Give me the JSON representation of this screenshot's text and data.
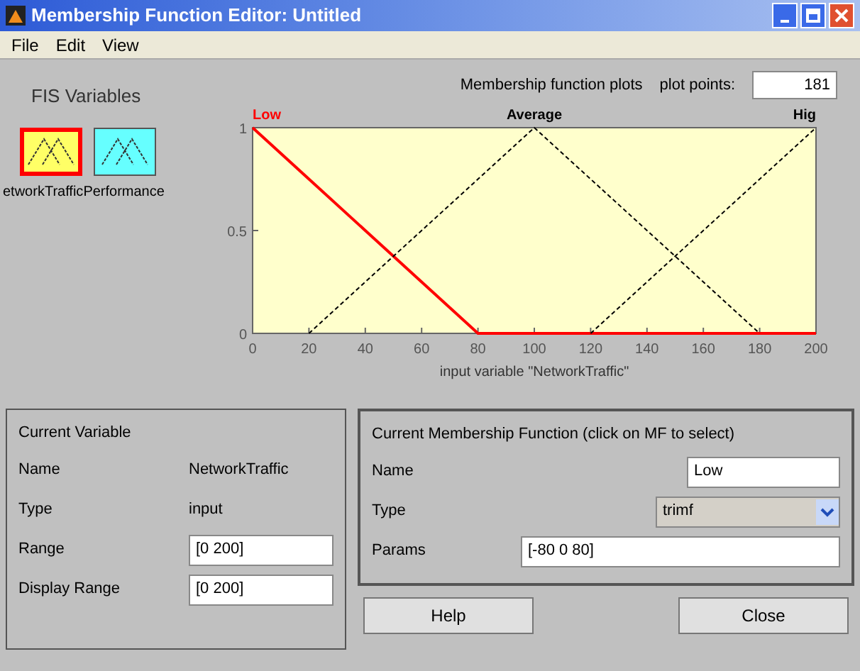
{
  "window": {
    "title": "Membership Function Editor: Untitled"
  },
  "menu": [
    "File",
    "Edit",
    "View"
  ],
  "fis_variables": {
    "title": "FIS Variables",
    "items": [
      {
        "label": "etworkTraffic",
        "selected": true
      },
      {
        "label": "Performance",
        "selected": false
      }
    ]
  },
  "plot_header": {
    "title": "Membership function plots",
    "points_label": "plot points:",
    "points_value": "181"
  },
  "chart_data": {
    "type": "line",
    "xlabel": "input variable \"NetworkTraffic\"",
    "x": [
      0,
      20,
      40,
      60,
      80,
      100,
      120,
      140,
      160,
      180,
      200
    ],
    "xlim": [
      0,
      200
    ],
    "ylim": [
      0,
      1
    ],
    "xticks": [
      0,
      20,
      40,
      60,
      80,
      100,
      120,
      140,
      160,
      180,
      200
    ],
    "yticks": [
      0,
      0.5,
      1
    ],
    "series": [
      {
        "name": "Low",
        "color": "#ff0000",
        "line_style": "solid",
        "values": [
          1,
          0.75,
          0.5,
          0.25,
          0,
          0,
          0,
          0,
          0,
          0,
          0
        ]
      },
      {
        "name": "Average",
        "color": "#000000",
        "line_style": "dashed",
        "values": [
          null,
          0,
          0.25,
          0.5,
          0.75,
          1,
          0.75,
          0.5,
          0.25,
          0,
          null
        ]
      },
      {
        "name": "Hig",
        "color": "#000000",
        "line_style": "dashed",
        "values": [
          null,
          null,
          null,
          null,
          null,
          null,
          0,
          0.25,
          0.5,
          0.75,
          1
        ]
      }
    ]
  },
  "current_variable": {
    "title": "Current Variable",
    "fields": [
      {
        "label": "Name",
        "value": "NetworkTraffic",
        "kind": "text"
      },
      {
        "label": "Type",
        "value": "input",
        "kind": "text"
      },
      {
        "label": "Range",
        "value": "[0 200]",
        "kind": "input"
      },
      {
        "label": "Display Range",
        "value": "[0 200]",
        "kind": "input"
      }
    ]
  },
  "current_mf": {
    "title": "Current Membership Function (click on MF to select)",
    "fields": [
      {
        "label": "Name",
        "value": "Low",
        "kind": "input"
      },
      {
        "label": "Type",
        "value": "trimf",
        "kind": "select"
      },
      {
        "label": "Params",
        "value": "[-80 0 80]",
        "kind": "wide"
      }
    ]
  },
  "buttons": [
    "Help",
    "Close"
  ]
}
